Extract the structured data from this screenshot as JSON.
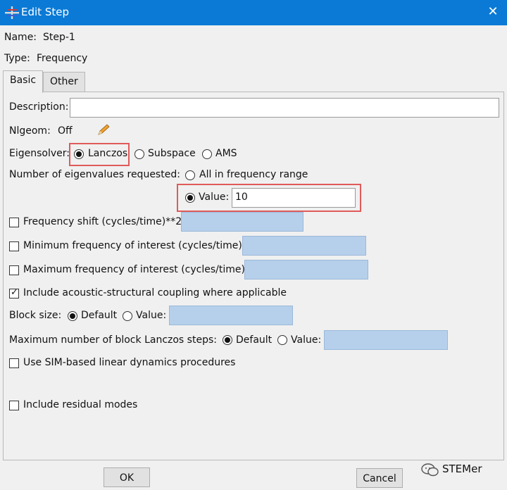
{
  "window": {
    "title": "Edit Step",
    "close_glyph": "✕",
    "app_icon": "abaqus-cross-icon"
  },
  "header": {
    "name_label": "Name:",
    "name_value": "Step-1",
    "type_label": "Type:",
    "type_value": "Frequency"
  },
  "tabs": [
    {
      "label": "Basic",
      "active": true
    },
    {
      "label": "Other",
      "active": false
    }
  ],
  "form": {
    "description_label": "Description:",
    "description_value": "",
    "nlgeom_label": "Nlgeom:",
    "nlgeom_value": "Off",
    "nlgeom_icon": "pencil-icon",
    "eigensolver_label": "Eigensolver:",
    "eigensolver_options": [
      "Lanczos",
      "Subspace",
      "AMS"
    ],
    "eigensolver_selected": "Lanczos",
    "num_eigen_label": "Number of eigenvalues requested:",
    "all_in_range_label": "All in frequency range",
    "value_label": "Value:",
    "value": "10",
    "freq_shift_label": "Frequency shift (cycles/time)**2:",
    "min_freq_label": "Minimum frequency of interest (cycles/time):",
    "max_freq_label": "Maximum frequency of interest (cycles/time):",
    "acoustic_label": "Include acoustic-structural coupling where applicable",
    "acoustic_checked": true,
    "block_size_label": "Block size:",
    "default_label": "Default",
    "block_value_label": "Value:",
    "max_lanczos_label": "Maximum number of block Lanczos steps:",
    "max_lanczos_default_label": "Default",
    "max_lanczos_value_label": "Value:",
    "sim_label": "Use SIM-based linear dynamics procedures",
    "residual_label": "Include residual modes",
    "checkmark_glyph": "✓"
  },
  "buttons": {
    "ok": "OK",
    "cancel": "Cancel"
  },
  "watermark": {
    "text": "STEMer",
    "icon": "wechat-icon"
  },
  "colors": {
    "title_bar": "#0a7ad6",
    "highlight": "#e05a5a",
    "disabled_field": "#b6d0ec"
  }
}
